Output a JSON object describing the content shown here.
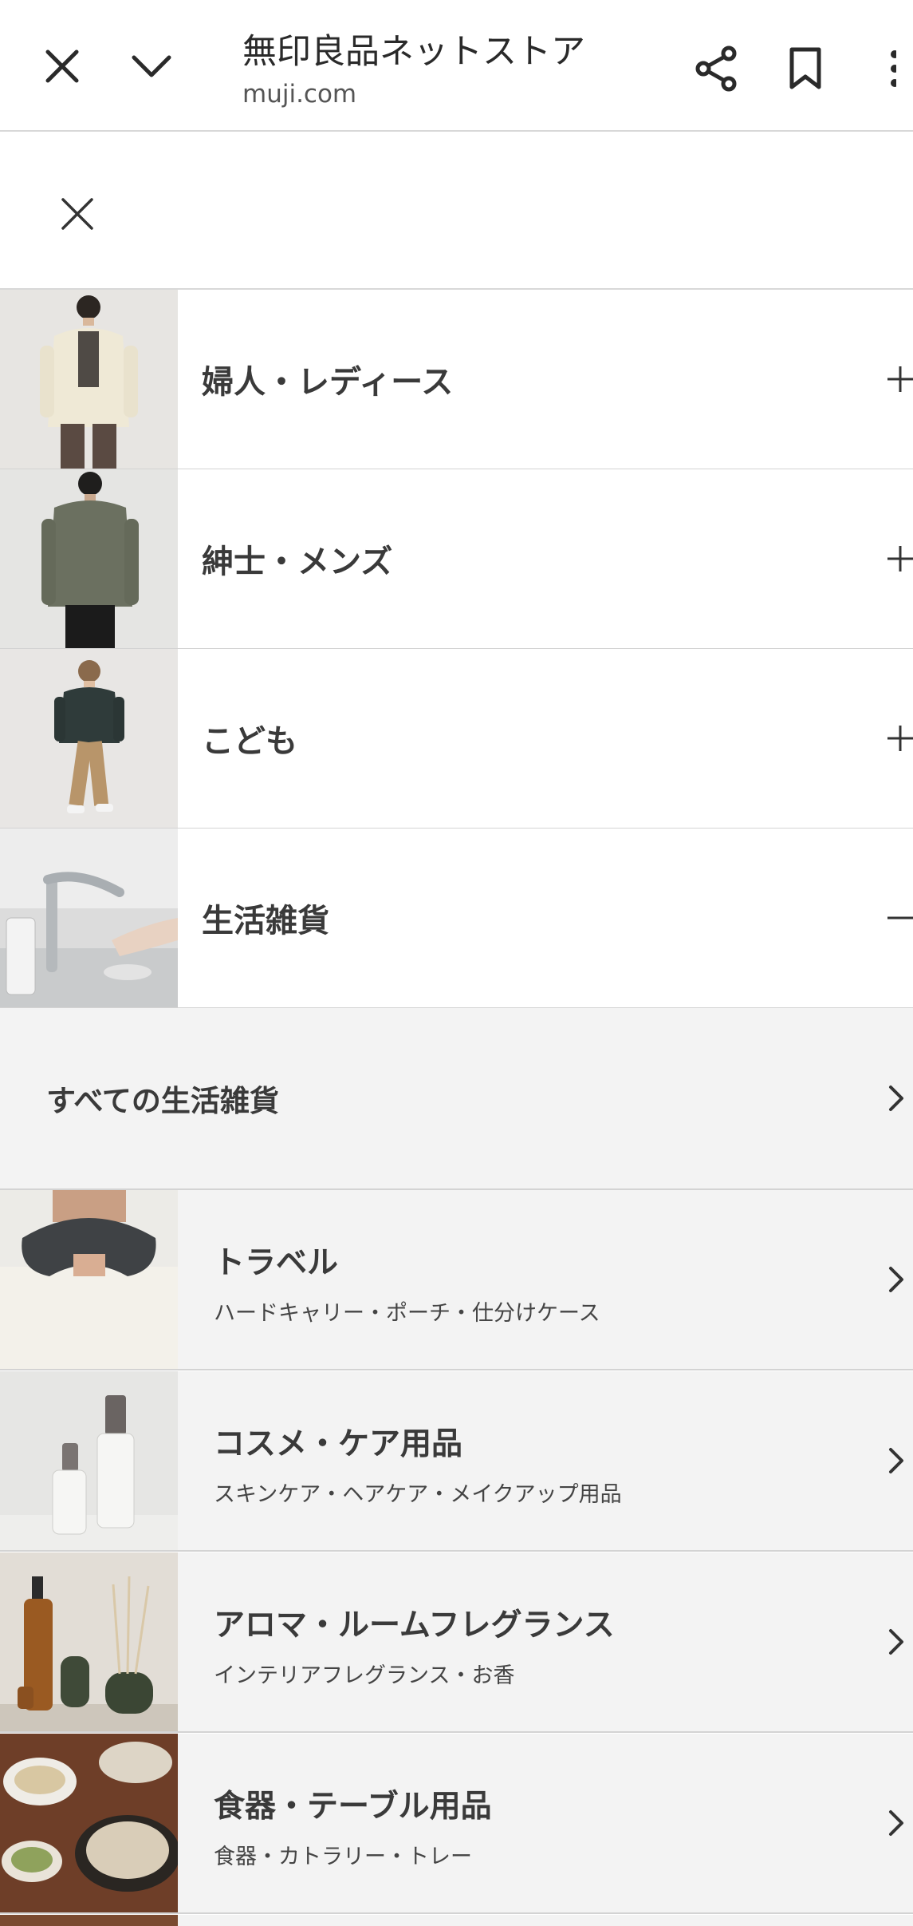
{
  "browser": {
    "title": "無印良品ネットストア",
    "domain": "muji.com",
    "icons": [
      "close-icon",
      "chevron-down-icon",
      "share-icon",
      "bookmark-icon",
      "more-vert-icon"
    ]
  },
  "menu": {
    "close_icon": "close-icon",
    "categories": [
      {
        "label": "婦人・レディース",
        "state": "collapsed",
        "icon": "plus-icon"
      },
      {
        "label": "紳士・メンズ",
        "state": "collapsed",
        "icon": "plus-icon"
      },
      {
        "label": "こども",
        "state": "collapsed",
        "icon": "plus-icon"
      },
      {
        "label": "生活雑貨",
        "state": "expanded",
        "icon": "minus-icon"
      }
    ],
    "all_link": "すべての生活雑貨",
    "subcategories": [
      {
        "title": "トラベル",
        "desc": "ハードキャリー・ポーチ・仕分けケース"
      },
      {
        "title": "コスメ・ケア用品",
        "desc": "スキンケア・ヘアケア・メイクアップ用品"
      },
      {
        "title": "アロマ・ルームフレグランス",
        "desc": "インテリアフレグランス・お香"
      },
      {
        "title": "食器・テーブル用品",
        "desc": "食器・カトラリー・トレー"
      }
    ]
  },
  "colors": {
    "text": "#333333",
    "divider": "#d3d3d3",
    "expanded_bg": "#f3f3f3"
  }
}
